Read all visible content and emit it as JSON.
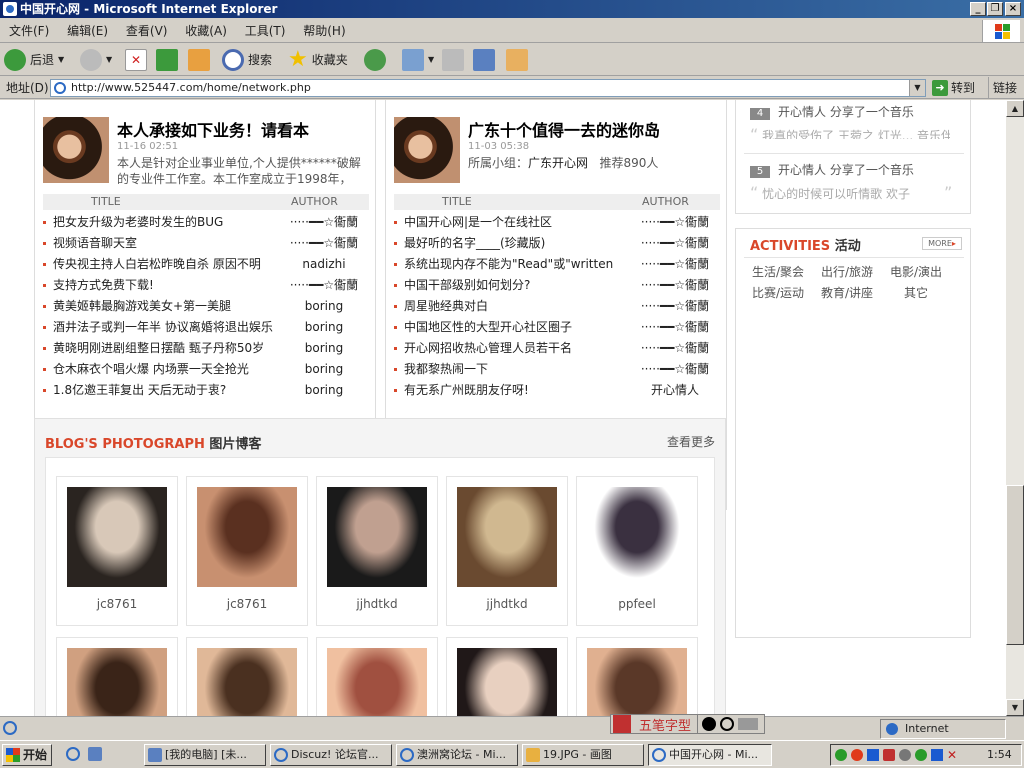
{
  "window": {
    "title": "中国开心网 - Microsoft Internet Explorer",
    "buttons": [
      "_",
      "❐",
      "×"
    ]
  },
  "menu": [
    "文件(F)",
    "编辑(E)",
    "查看(V)",
    "收藏(A)",
    "工具(T)",
    "帮助(H)"
  ],
  "toolbar": {
    "back": "后退",
    "search": "搜索",
    "favorites": "收藏夹"
  },
  "address": {
    "label": "地址(D)",
    "url": "http://www.525447.com/home/network.php",
    "go": "转到",
    "links": "链接"
  },
  "left_post": {
    "title": "本人承接如下业务！请看本",
    "date": "11-16 02:51",
    "desc": "本人是针对企业事业单位,个人提供******破解的专业件工作室。本工作室成立于1998年，",
    "th_title": "TITLE",
    "th_author": "AUTHOR",
    "rows": [
      {
        "t": "把女友升级为老婆时发生的BUG",
        "a": "·····━━☆衞蘭"
      },
      {
        "t": "视频语音聊天室",
        "a": "·····━━☆衞蘭"
      },
      {
        "t": "传央视主持人白岩松昨晚自杀 原因不明",
        "a": "nadizhi"
      },
      {
        "t": "支持方式免费下载!",
        "a": "·····━━☆衞蘭"
      },
      {
        "t": "黄美姬韩最胸游戏美女+第一美腿",
        "a": "boring"
      },
      {
        "t": "酒井法子或判一年半 协议离婚将退出娱乐",
        "a": "boring"
      },
      {
        "t": "黄晓明刚进剧组整日摆酷 甄子丹称50岁",
        "a": "boring"
      },
      {
        "t": "仓木麻衣个唱火爆 内场票一天全抢光",
        "a": "boring"
      },
      {
        "t": "1.8亿邀王菲复出 天后无动于衷?",
        "a": "boring"
      }
    ]
  },
  "right_post": {
    "title": "广东十个值得一去的迷你岛",
    "date": "11-03 05:38",
    "group_label": "所属小组：",
    "group": "广东开心网",
    "recommend": "推荐890人",
    "th_title": "TITLE",
    "th_author": "AUTHOR",
    "rows": [
      {
        "t": "中国开心网|是一个在线社区",
        "a": "·····━━☆衞蘭"
      },
      {
        "t": "最好听的名字____(珍藏版)",
        "a": "·····━━☆衞蘭"
      },
      {
        "t": "系统出现内存不能为\"Read\"或\"written",
        "a": "·····━━☆衞蘭"
      },
      {
        "t": "中国干部级别如何划分?",
        "a": "·····━━☆衞蘭"
      },
      {
        "t": "周星驰经典对白",
        "a": "·····━━☆衞蘭"
      },
      {
        "t": "中国地区性的大型开心社区圈子",
        "a": "·····━━☆衞蘭"
      },
      {
        "t": "开心网招收热心管理人员若干名",
        "a": "·····━━☆衞蘭"
      },
      {
        "t": "我都黎热闹一下",
        "a": "·····━━☆衞蘭"
      },
      {
        "t": "有无系广州既朋友仔呀!",
        "a": "开心情人"
      }
    ]
  },
  "feed": [
    {
      "num": "4",
      "text": "开心情人  分享了一个音乐",
      "quote": "我真的受伤了  王菀之  灯光... 音乐伴离了"
    },
    {
      "num": "5",
      "text": "开心情人  分享了一个音乐",
      "quote": "忧心的时候可以听情歌  欢子"
    }
  ],
  "activities": {
    "title_en": "ACTIVITIES",
    "title_cn": "活动",
    "more": "MORE",
    "items": [
      "生活/聚会",
      "出行/旅游",
      "电影/演出",
      "比赛/运动",
      "教育/讲座",
      "其它"
    ]
  },
  "photos": {
    "title_en": "BLOG'S PHOTOGRAPH",
    "title_cn": "图片博客",
    "more": "查看更多",
    "items": [
      {
        "cap": "jc8761",
        "c1": "#2a2420",
        "c2": "#d8c8b8"
      },
      {
        "cap": "jc8761",
        "c1": "#c89070",
        "c2": "#5a3020"
      },
      {
        "cap": "jjhdtkd",
        "c1": "#1a1a1a",
        "c2": "#c0a090"
      },
      {
        "cap": "jjhdtkd",
        "c1": "#6a4a30",
        "c2": "#d0b890"
      },
      {
        "cap": "ppfeel",
        "c1": "#ffffff",
        "c2": "#3a3040"
      },
      {
        "cap": "",
        "c1": "#d0a080",
        "c2": "#3a2418"
      },
      {
        "cap": "",
        "c1": "#e0b898",
        "c2": "#4a3020"
      },
      {
        "cap": "",
        "c1": "#f0c0a0",
        "c2": "#a05040"
      },
      {
        "cap": "",
        "c1": "#201818",
        "c2": "#e8d0c0"
      },
      {
        "cap": "",
        "c1": "#e0b090",
        "c2": "#5a3828"
      }
    ]
  },
  "status": {
    "zone": "Internet"
  },
  "ime": {
    "label": "五笔字型"
  },
  "taskbar": {
    "start": "开始",
    "tasks": [
      "[我的电脑] [未...",
      "Discuz! 论坛官...",
      "澳洲窝论坛 - Mi...",
      "19.JPG - 画图",
      "中国开心网 - Mi..."
    ],
    "clock": "1:54"
  }
}
